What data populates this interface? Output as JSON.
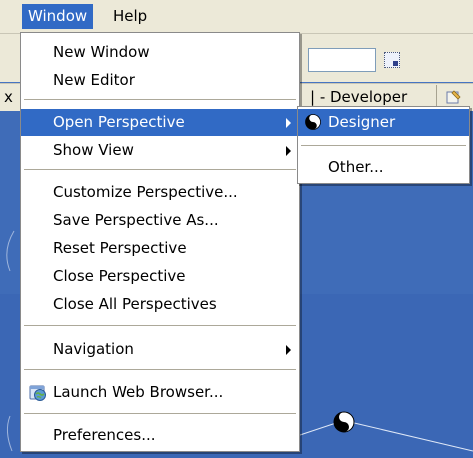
{
  "menubar": {
    "items": [
      {
        "label": "Window"
      },
      {
        "label": "Help"
      }
    ]
  },
  "perspective_bar": {
    "left_text": "x",
    "active_tab": "| - Developer"
  },
  "window_menu": {
    "items": [
      {
        "label": "New Window"
      },
      {
        "label": "New Editor"
      },
      {
        "label": "Open Perspective",
        "submenu": true,
        "highlighted": true
      },
      {
        "label": "Show View",
        "submenu": true
      },
      {
        "label": "Customize Perspective..."
      },
      {
        "label": "Save Perspective As..."
      },
      {
        "label": "Reset Perspective"
      },
      {
        "label": "Close Perspective"
      },
      {
        "label": "Close All Perspectives"
      },
      {
        "label": "Navigation",
        "submenu": true
      },
      {
        "label": "Launch Web Browser...",
        "icon": "web-browser-icon"
      },
      {
        "label": "Preferences..."
      }
    ]
  },
  "open_perspective_submenu": {
    "items": [
      {
        "label": "Designer",
        "icon": "yin-yang-icon",
        "highlighted": true
      },
      {
        "label": "Other..."
      }
    ]
  },
  "colors": {
    "highlight": "#316ac5",
    "menu_background": "#ffffff",
    "chrome": "#ece9d8",
    "workspace": "#3f6cb8"
  }
}
